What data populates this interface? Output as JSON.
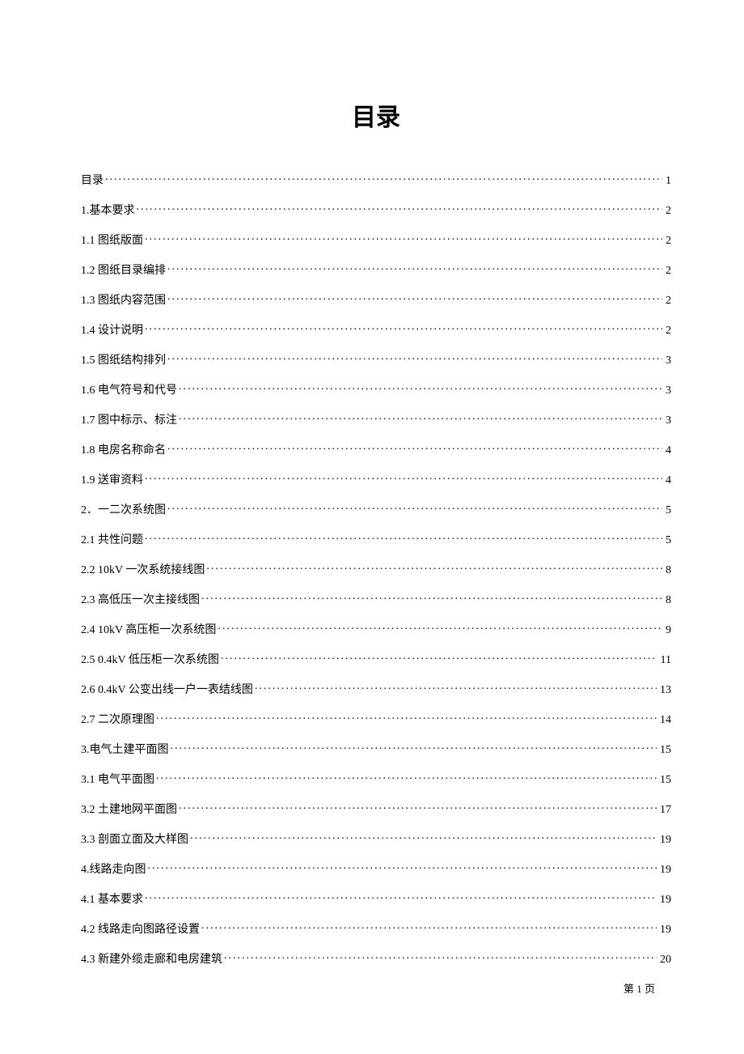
{
  "title": "目录",
  "toc": [
    {
      "label": "目录",
      "page": "1"
    },
    {
      "label": "1.基本要求",
      "page": "2"
    },
    {
      "label": "1.1 图纸版面",
      "page": "2"
    },
    {
      "label": "1.2 图纸目录编排",
      "page": "2"
    },
    {
      "label": "1.3 图纸内容范围",
      "page": "2"
    },
    {
      "label": "1.4 设计说明",
      "page": "2"
    },
    {
      "label": "1.5 图纸结构排列",
      "page": "3"
    },
    {
      "label": "1.6 电气符号和代号",
      "page": "3"
    },
    {
      "label": "1.7 图中标示、标注",
      "page": "3"
    },
    {
      "label": "1.8 电房名称命名",
      "page": "4"
    },
    {
      "label": "1.9 送审资料",
      "page": "4"
    },
    {
      "label": "2．一二次系统图",
      "page": "5"
    },
    {
      "label": "2.1 共性问题",
      "page": "5"
    },
    {
      "label": "2.2 10kV 一次系统接线图",
      "page": "8"
    },
    {
      "label": "2.3 高低压一次主接线图",
      "page": "8"
    },
    {
      "label": "2.4 10kV 高压柜一次系统图",
      "page": "9"
    },
    {
      "label": "2.5 0.4kV 低压柜一次系统图",
      "page": "11"
    },
    {
      "label": "2.6 0.4kV 公变出线一户一表结线图",
      "page": "13"
    },
    {
      "label": "2.7 二次原理图",
      "page": "14"
    },
    {
      "label": "3.电气土建平面图",
      "page": "15"
    },
    {
      "label": "3.1 电气平面图",
      "page": "15"
    },
    {
      "label": "3.2 土建地网平面图",
      "page": "17"
    },
    {
      "label": "3.3 剖面立面及大样图",
      "page": "19"
    },
    {
      "label": "4.线路走向图",
      "page": "19"
    },
    {
      "label": "4.1 基本要求",
      "page": "19"
    },
    {
      "label": "4.2 线路走向图路径设置",
      "page": "19"
    },
    {
      "label": "4.3 新建外缆走廊和电房建筑",
      "page": "20"
    }
  ],
  "footer": "第 1 页"
}
